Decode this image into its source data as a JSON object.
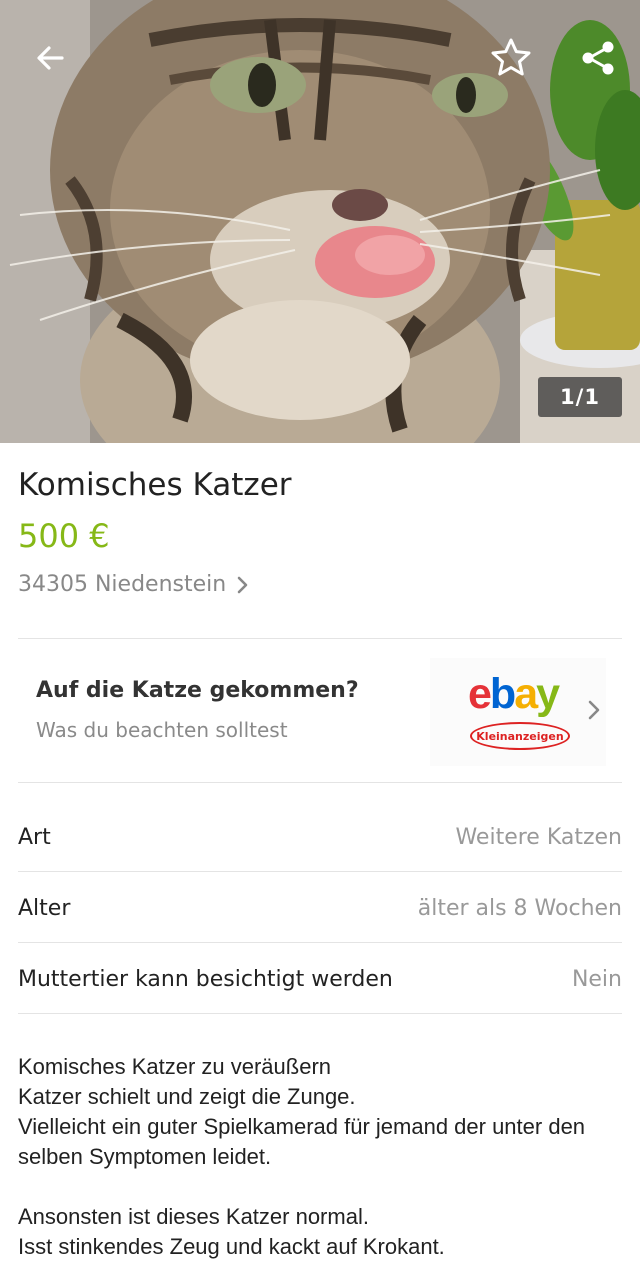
{
  "photo": {
    "counter": "1/1",
    "icons": {
      "back": "back-arrow-icon",
      "favorite": "star-outline-icon",
      "share": "share-icon"
    }
  },
  "listing": {
    "title": "Komisches Katzer",
    "price": "500 €",
    "location": "34305 Niedenstein"
  },
  "banner": {
    "title": "Auf die Katze gekommen?",
    "subtitle": "Was du beachten solltest",
    "logo_text": "ebay",
    "logo_sub": "Kleinanzeigen"
  },
  "attributes": [
    {
      "label": "Art",
      "value": "Weitere Katzen"
    },
    {
      "label": "Alter",
      "value": "älter als 8 Wochen"
    },
    {
      "label": "Muttertier kann besichtigt werden",
      "value": "Nein"
    }
  ],
  "description": "Komisches Katzer zu veräußern\nKatzer schielt und zeigt die Zunge.\nVielleicht ein guter Spielkamerad für jemand der unter den selben Symptomen leidet.\n\nAnsonsten ist dieses Katzer normal.\nIsst stinkendes Zeug und kackt auf Krokant.",
  "colors": {
    "price": "#86b817",
    "muted": "#888888",
    "divider": "#e4e4e4"
  }
}
